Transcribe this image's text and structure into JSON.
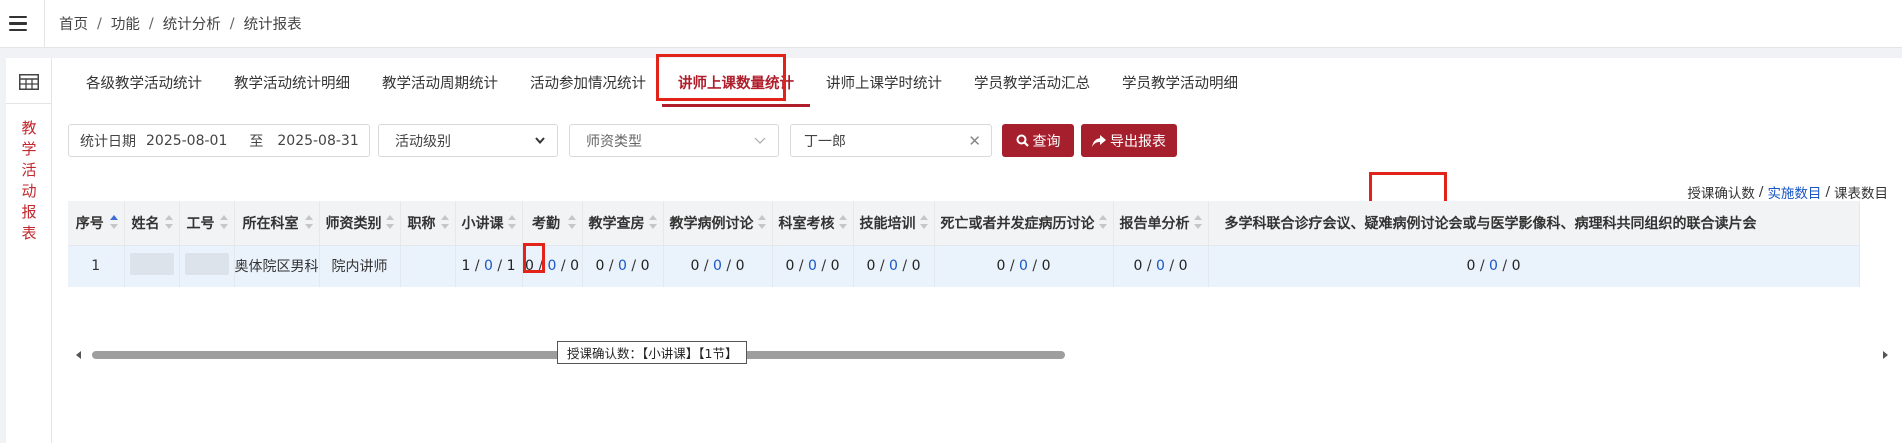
{
  "breadcrumb": [
    "首页",
    "功能",
    "统计分析",
    "统计报表"
  ],
  "sidebar": {
    "title_chars": [
      "教",
      "学",
      "活",
      "动",
      "报",
      "表"
    ]
  },
  "tabs": [
    {
      "label": "各级教学活动统计"
    },
    {
      "label": "教学活动统计明细"
    },
    {
      "label": "教学活动周期统计"
    },
    {
      "label": "活动参加情况统计"
    },
    {
      "label": "讲师上课数量统计",
      "active": true
    },
    {
      "label": "讲师上课学时统计"
    },
    {
      "label": "学员教学活动汇总"
    },
    {
      "label": "学员教学活动明细"
    }
  ],
  "filters": {
    "date_label": "统计日期",
    "date_from": "2025-08-01",
    "date_sep": "至",
    "date_to": "2025-08-31",
    "level_select": "活动级别",
    "teacher_type_select": "师资类型",
    "name_value": "丁一郎"
  },
  "buttons": {
    "query": "查询",
    "export": "导出报表"
  },
  "legend": {
    "confirmed": "授课确认数",
    "sep": "/",
    "implemented": "实施数目",
    "scheduled": "课表数目"
  },
  "table": {
    "columns": [
      "序号",
      "姓名",
      "工号",
      "所在科室",
      "师资类别",
      "职称",
      "小讲课",
      "考勤",
      "教学查房",
      "教学病例讨论",
      "科室考核",
      "技能培训",
      "死亡或者并发症病历讨论",
      "报告单分析",
      "多学科联合诊疗会议、疑难病例讨论会或与医学影像科、病理科共同组织的联合读片会"
    ],
    "row": {
      "index": "1",
      "dept": "奥体院区男科",
      "category": "院内讲师",
      "title": "",
      "counts": [
        [
          "1",
          "0",
          "1"
        ],
        [
          "0",
          "0",
          "0"
        ],
        [
          "0",
          "0",
          "0"
        ],
        [
          "0",
          "0",
          "0"
        ],
        [
          "0",
          "0",
          "0"
        ],
        [
          "0",
          "0",
          "0"
        ],
        [
          "0",
          "0",
          "0"
        ],
        [
          "0",
          "0",
          "0"
        ],
        [
          "0",
          "0",
          "0"
        ]
      ]
    }
  },
  "tooltip": "授课确认数：【小讲课】【1节】",
  "colors": {
    "brand": "#a51f2c",
    "link": "#1a56c7",
    "highlight": "#e2231a"
  }
}
